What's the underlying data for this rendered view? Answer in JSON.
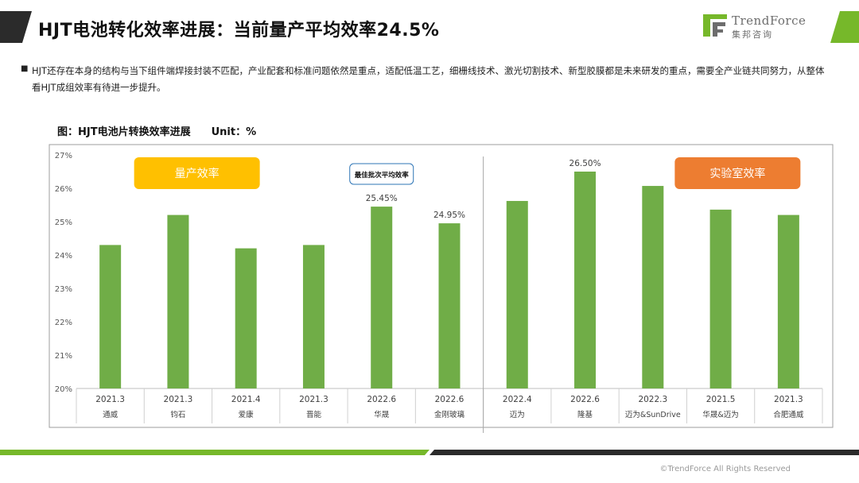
{
  "header": {
    "title": "HJT电池转化效率进展：当前量产平均效率24.5%",
    "logo_name": "TrendForce",
    "logo_sub": "集邦咨询"
  },
  "body": {
    "description": "HJT还存在本身的结构与当下组件端焊接封装不匹配，产业配套和标准问题依然是重点，适配低温工艺，细栅线技术、激光切割技术、新型胶膜都是未来研发的重点，需要全产业链共同努力，从整体看HJT成组效率有待进一步提升。"
  },
  "chart_caption": {
    "title": "图：HJT电池片转换效率进展",
    "unit": "Unit：%"
  },
  "chart_data": {
    "type": "bar",
    "categories": [
      {
        "date": "2021.3",
        "company": "通威"
      },
      {
        "date": "2021.3",
        "company": "钧石"
      },
      {
        "date": "2021.4",
        "company": "爱康"
      },
      {
        "date": "2021.3",
        "company": "晋能"
      },
      {
        "date": "2022.6",
        "company": "华晟"
      },
      {
        "date": "2022.6",
        "company": "金刚玻璃"
      },
      {
        "date": "2022.4",
        "company": "迈为"
      },
      {
        "date": "2022.6",
        "company": "隆基"
      },
      {
        "date": "2022.3",
        "company": "迈为&SunDrive"
      },
      {
        "date": "2021.5",
        "company": "华晟&迈为"
      },
      {
        "date": "2021.3",
        "company": "合肥通威"
      }
    ],
    "values": [
      24.3,
      25.2,
      24.2,
      24.3,
      25.45,
      24.95,
      25.62,
      26.5,
      26.07,
      25.36,
      25.2
    ],
    "data_labels": [
      {
        "index": 4,
        "text": "25.45%"
      },
      {
        "index": 5,
        "text": "24.95%"
      },
      {
        "index": 7,
        "text": "26.50%"
      }
    ],
    "ylim": [
      20,
      27
    ],
    "yticks": [
      "20%",
      "21%",
      "22%",
      "23%",
      "24%",
      "25%",
      "26%",
      "27%"
    ],
    "groups": [
      {
        "label": "量产效率",
        "from": 0,
        "to": 5,
        "color": "#ffc000"
      },
      {
        "label": "实验室效率",
        "from": 6,
        "to": 10,
        "color": "#ed7d31"
      }
    ],
    "callout": {
      "text": "最佳批次平均效率",
      "index": 4
    },
    "bar_color": "#70ad47",
    "grid": false
  },
  "footer": {
    "copyright": "©TrendForce All Rights Reserved"
  }
}
